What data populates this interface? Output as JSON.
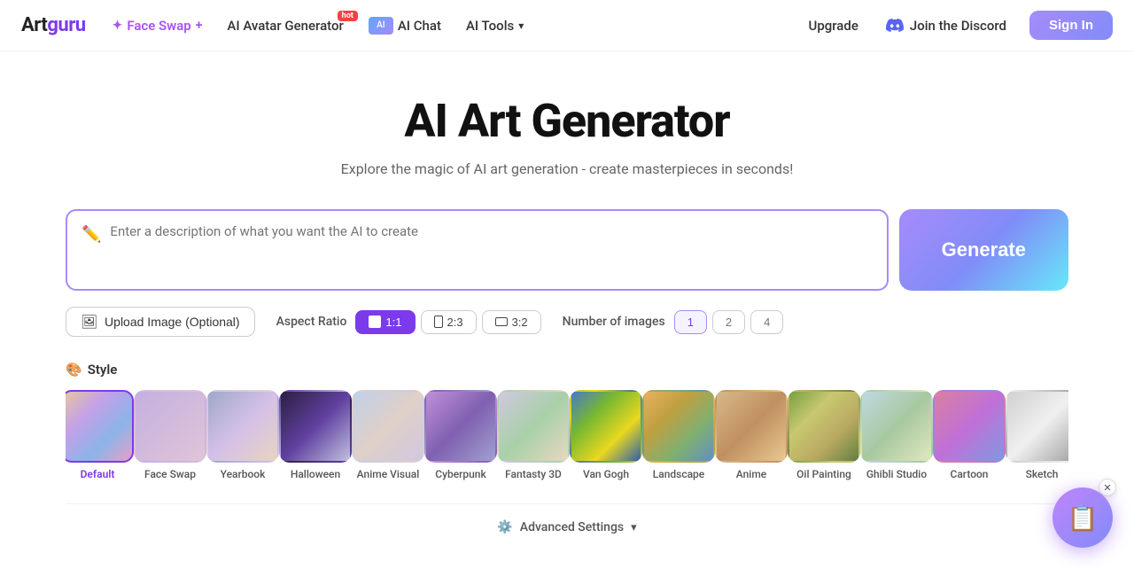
{
  "brand": {
    "name": "Artguru",
    "name_art": "art",
    "name_guru": "guru"
  },
  "navbar": {
    "faceswap_label": "Face Swap",
    "faceswap_badge": "hot",
    "avatar_label": "AI Avatar Generator",
    "aichat_label": "AI Chat",
    "aitools_label": "AI Tools",
    "upgrade_label": "Upgrade",
    "discord_label": "Join the Discord",
    "signin_label": "Sign In"
  },
  "hero": {
    "title": "AI Art Generator",
    "subtitle": "Explore the magic of AI art generation - create masterpieces in seconds!"
  },
  "prompt": {
    "placeholder": "Enter a description of what you want the AI to create",
    "icon": "✏️",
    "generate_label": "Generate"
  },
  "upload": {
    "label": "Upload Image (Optional)"
  },
  "aspect_ratio": {
    "label": "Aspect Ratio",
    "options": [
      {
        "value": "1:1",
        "label": "1:1",
        "active": true
      },
      {
        "value": "2:3",
        "label": "2:3",
        "active": false
      },
      {
        "value": "3:2",
        "label": "3:2",
        "active": false
      }
    ]
  },
  "num_images": {
    "label": "Number of images",
    "options": [
      {
        "value": "1",
        "label": "1",
        "active": true
      },
      {
        "value": "2",
        "label": "2",
        "active": false
      },
      {
        "value": "4",
        "label": "4",
        "active": false
      }
    ]
  },
  "style": {
    "section_label": "Style",
    "section_icon": "🎨",
    "items": [
      {
        "id": "default",
        "name": "Default",
        "class": "thumb-default",
        "active": true
      },
      {
        "id": "faceswap",
        "name": "Face Swap",
        "class": "thumb-faceswap",
        "active": false
      },
      {
        "id": "yearbook",
        "name": "Yearbook",
        "class": "thumb-yearbook",
        "active": false
      },
      {
        "id": "halloween",
        "name": "Halloween",
        "class": "thumb-halloween",
        "active": false
      },
      {
        "id": "anime-visual",
        "name": "Anime Visual",
        "class": "thumb-anime-visual",
        "active": false
      },
      {
        "id": "cyberpunk",
        "name": "Cyberpunk",
        "class": "thumb-cyberpunk",
        "active": false
      },
      {
        "id": "fantasy3d",
        "name": "Fantasty 3D",
        "class": "thumb-fantasy3d",
        "active": false
      },
      {
        "id": "vangogh",
        "name": "Van Gogh",
        "class": "thumb-vangogh",
        "active": false
      },
      {
        "id": "landscape",
        "name": "Landscape",
        "class": "thumb-landscape",
        "active": false
      },
      {
        "id": "anime",
        "name": "Anime",
        "class": "thumb-anime",
        "active": false
      },
      {
        "id": "oilpainting",
        "name": "Oil Painting",
        "class": "thumb-oilpainting",
        "active": false
      },
      {
        "id": "ghibli",
        "name": "Ghibli Studio",
        "class": "thumb-ghibli",
        "active": false
      },
      {
        "id": "cartoon",
        "name": "Cartoon",
        "class": "thumb-cartoon",
        "active": false
      },
      {
        "id": "sketch",
        "name": "Sketch",
        "class": "thumb-sketch",
        "active": false
      }
    ]
  },
  "advanced": {
    "label": "Advanced Settings",
    "icon": "⚙️"
  }
}
